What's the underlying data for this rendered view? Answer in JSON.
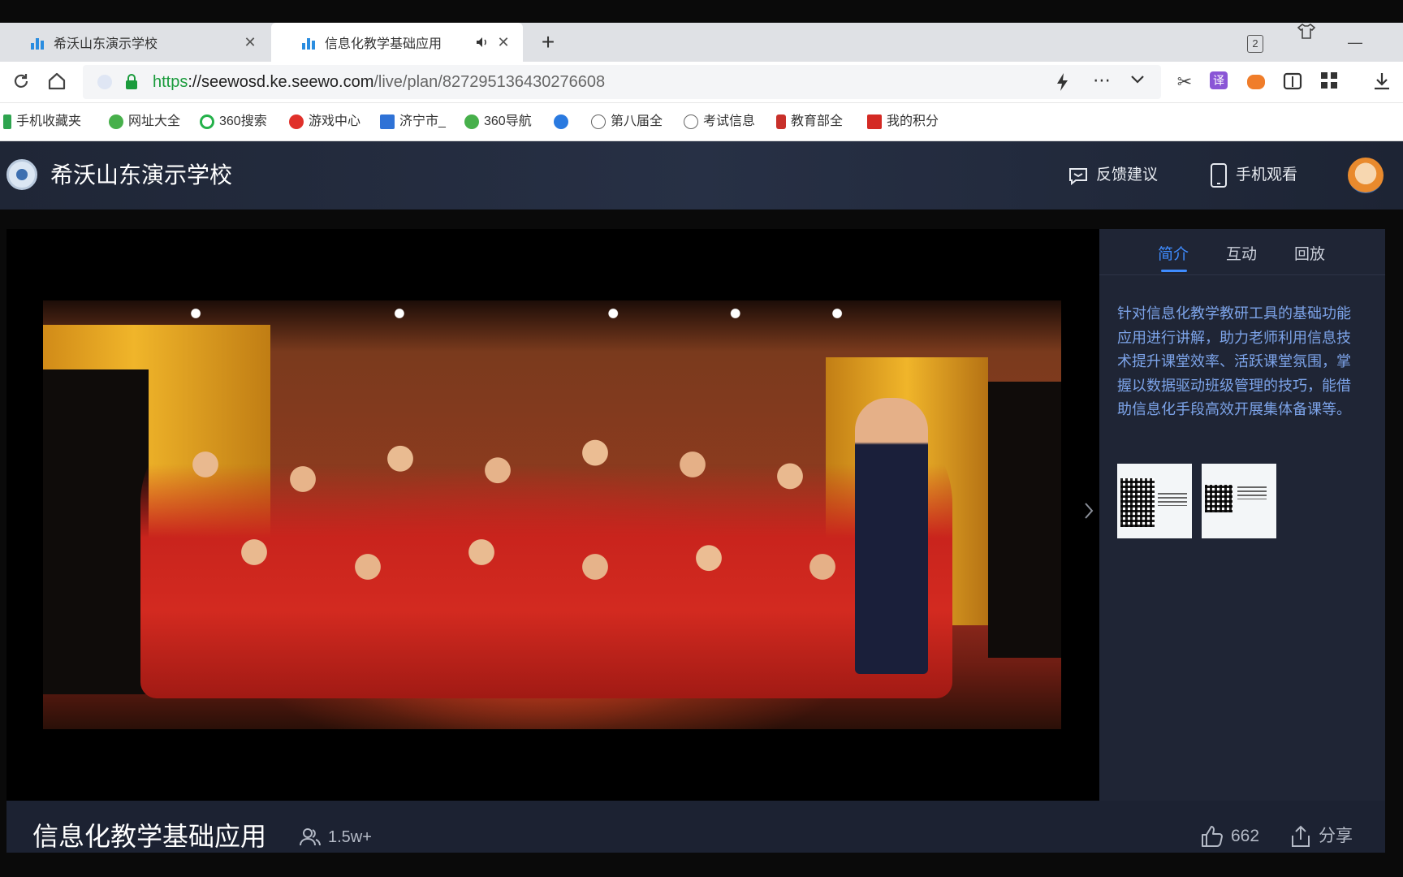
{
  "browser": {
    "tabs": [
      {
        "title": "希沃山东演示学校",
        "close": "✕"
      },
      {
        "title": "信息化教学基础应用",
        "close": "✕",
        "audio": "🔊"
      }
    ],
    "new_tab": "+",
    "window_count": "2",
    "url": {
      "proto": "https",
      "host": "://seewosd.ke.seewo.com",
      "path": "/live/plan/827295136430276608"
    },
    "bookmarks": [
      "手机收藏夹",
      "网址大全",
      "360搜索",
      "游戏中心",
      "济宁市_",
      "360导航",
      "",
      "第八届全",
      "考试信息",
      "教育部全",
      "我的积分"
    ]
  },
  "site": {
    "school_name": "希沃山东演示学校",
    "feedback": "反馈建议",
    "mobile_watch": "手机观看"
  },
  "sidebar": {
    "tabs": [
      "简介",
      "互动",
      "回放"
    ],
    "intro": "针对信息化教学教研工具的基础功能应用进行讲解，助力老师利用信息技术提升课堂效率、活跃课堂氛围，掌握以数据驱动班级管理的技巧，能借助信息化手段高效开展集体备课等。"
  },
  "video": {
    "title": "信息化教学基础应用",
    "viewers": "1.5w+",
    "likes": "662",
    "share": "分享"
  },
  "colors": {
    "accent": "#3f8cff",
    "intro_text": "#7ca3e8",
    "header_bg": "#1f2636"
  }
}
